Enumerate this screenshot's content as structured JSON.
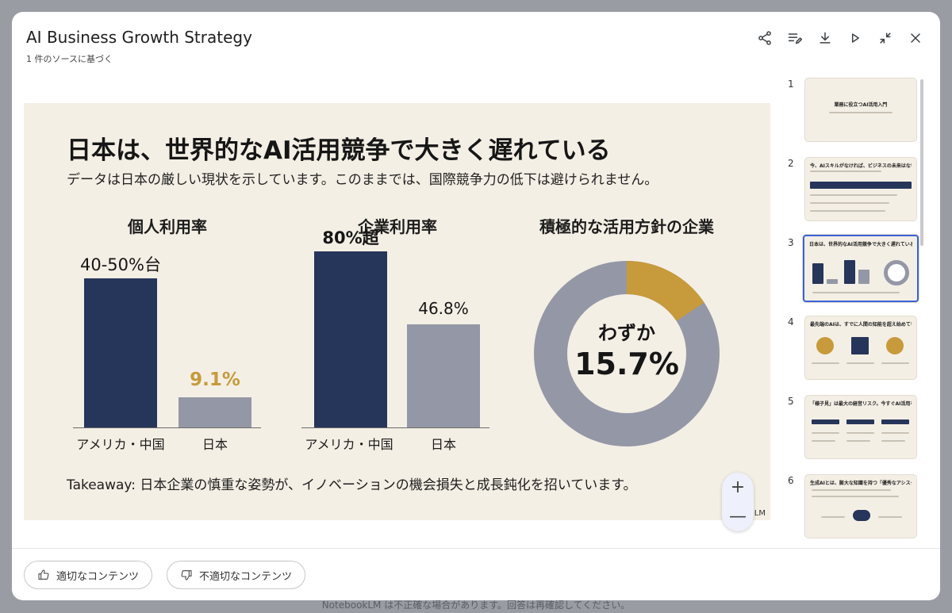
{
  "window": {
    "title": "AI Business Growth Strategy",
    "subtitle": "1 件のソースに基づく"
  },
  "toolbar": {
    "icons": [
      "share-icon",
      "edit-list-icon",
      "download-icon",
      "play-icon",
      "collapse-icon",
      "close-icon"
    ]
  },
  "slide": {
    "heading": "日本は、世界的なAI活用競争で大きく遅れている",
    "subheading": "データは日本の厳しい現状を示しています。このままでは、国際競争力の低下は避けられません。",
    "takeaway": "Takeaway: 日本企業の慎重な姿勢が、イノベーションの機会損失と成長鈍化を招いています。",
    "brand": "LM",
    "colors": {
      "navy": "#26355a",
      "gray": "#9497a6",
      "gold": "#c79a3b",
      "background": "#f4efe5"
    }
  },
  "chart_data": [
    {
      "type": "bar",
      "title": "個人利用率",
      "categories": [
        "アメリカ・中国",
        "日本"
      ],
      "values": [
        45,
        9.1
      ],
      "value_labels": [
        "40-50%台",
        "9.1%"
      ],
      "ylim": [
        0,
        55
      ]
    },
    {
      "type": "bar",
      "title": "企業利用率",
      "categories": [
        "アメリカ・中国",
        "日本"
      ],
      "values": [
        80,
        46.8
      ],
      "value_labels": [
        "80%超",
        "46.8%"
      ],
      "ylim": [
        0,
        83
      ]
    },
    {
      "type": "pie",
      "title": "積極的な活用方針の企業",
      "values": [
        15.7,
        84.3
      ],
      "center_label_top": "わずか",
      "center_label_value": "15.7%"
    }
  ],
  "zoom": {
    "in": "+",
    "out": "—"
  },
  "thumbnails": [
    {
      "number": "1",
      "title": "業務に役立つAI活用入門"
    },
    {
      "number": "2",
      "title": "今、AIスキルがなければ、ビジネスの未来はない"
    },
    {
      "number": "3",
      "title": "日本は、世界的なAI活用競争で大きく遅れている"
    },
    {
      "number": "4",
      "title": "最先端のAIは、すでに人間の知能を超え始めている"
    },
    {
      "number": "5",
      "title": "「様子見」は最大の経営リスク。今すぐAI活用を始めるべき3つの理由"
    },
    {
      "number": "6",
      "title": "生成AIとは、膨大な知識を持つ「優秀なアシスタント」である"
    }
  ],
  "feedback": {
    "good": "適切なコンテンツ",
    "bad": "不適切なコンテンツ"
  },
  "footer_note": "NotebookLM は不正確な場合があります。回答は再確認してください。"
}
